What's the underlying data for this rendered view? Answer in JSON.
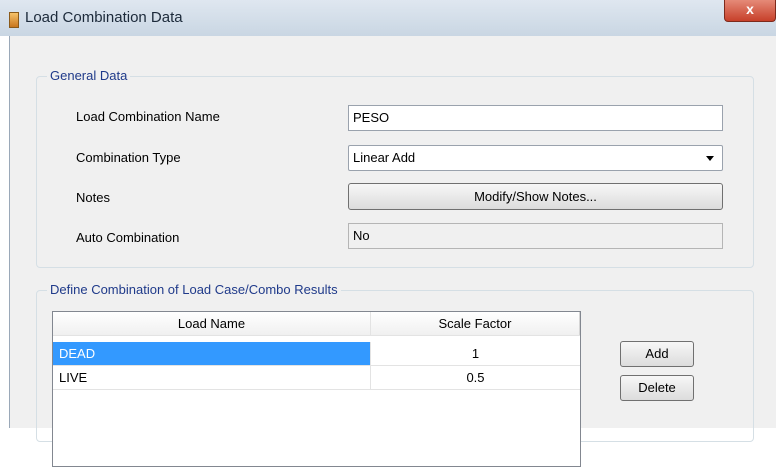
{
  "window": {
    "title": "Load Combination Data",
    "close_label": "x",
    "icon": "app-icon"
  },
  "general": {
    "legend": "General Data",
    "name_label": "Load Combination Name",
    "name_value": "PESO",
    "type_label": "Combination Type",
    "type_value": "Linear Add",
    "notes_label": "Notes",
    "notes_button": "Modify/Show Notes...",
    "auto_label": "Auto Combination",
    "auto_value": "No"
  },
  "define": {
    "legend": "Define Combination of Load Case/Combo Results",
    "columns": [
      "Load Name",
      "Scale Factor"
    ],
    "rows": [
      {
        "name": "DEAD",
        "factor": "1",
        "selected": true
      },
      {
        "name": "LIVE",
        "factor": "0.5",
        "selected": false
      }
    ],
    "add_button": "Add",
    "delete_button": "Delete"
  },
  "colors": {
    "selection": "#3399ff",
    "legend_text": "#1f3a8a"
  }
}
